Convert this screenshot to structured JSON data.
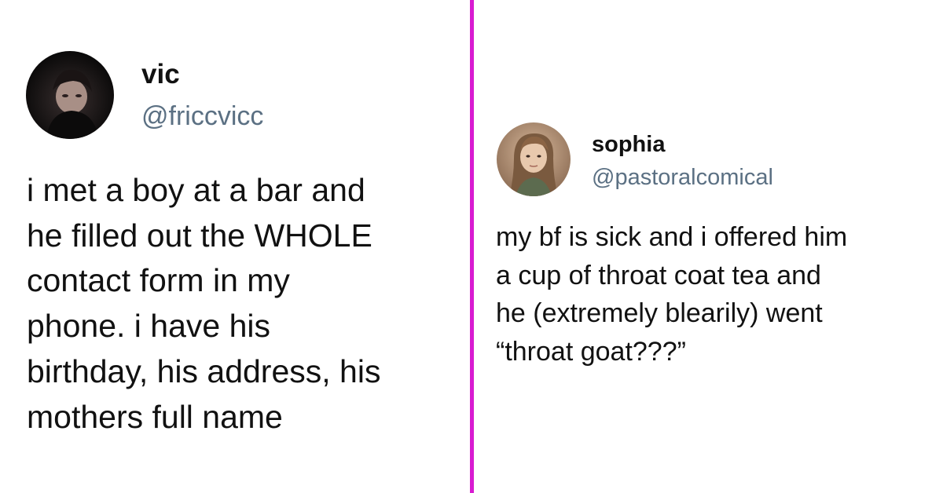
{
  "colors": {
    "divider": "#d81bd1",
    "handle": "#5b7083",
    "text": "#111111",
    "background": "#ffffff"
  },
  "tweets": [
    {
      "display_name": "vic",
      "handle": "@friccvicc",
      "avatar": "user-avatar-photo",
      "lines": [
        "i met a boy at a bar and",
        "he filled out the WHOLE",
        "contact form in my",
        "phone. i have his",
        "birthday, his address, his",
        "mothers full name"
      ]
    },
    {
      "display_name": "sophia",
      "handle": "@pastoralcomical",
      "avatar": "user-avatar-photo",
      "lines": [
        "my bf is sick and i offered him",
        "a cup of throat coat tea and",
        "he (extremely blearily) went",
        "“throat goat???”"
      ]
    }
  ]
}
